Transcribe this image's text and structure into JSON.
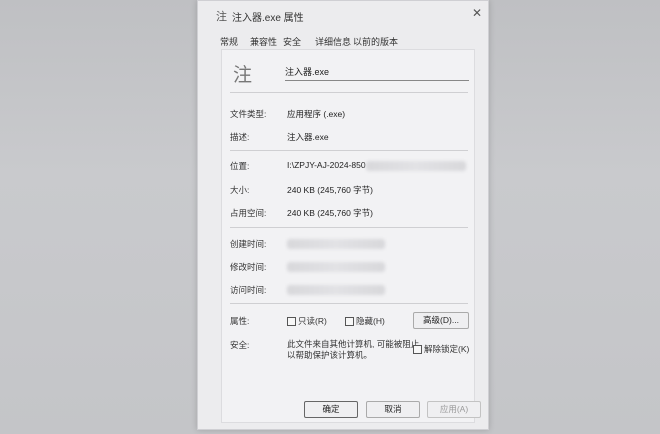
{
  "window": {
    "title_icon": "注",
    "title": "注入器.exe 属性",
    "close_icon": "✕"
  },
  "tabs": [
    {
      "label": "常规"
    },
    {
      "label": "兼容性"
    },
    {
      "label": "安全"
    },
    {
      "label": "详细信息"
    },
    {
      "label": "以前的版本"
    }
  ],
  "general": {
    "icon_glyph": "注",
    "filename": "注入器.exe",
    "file_type_label": "文件类型:",
    "file_type": "应用程序 (.exe)",
    "description_label": "描述:",
    "description": "注入器.exe",
    "location_label": "位置:",
    "location": "I:\\ZPJY-AJ-2024-850",
    "size_label": "大小:",
    "size": "240 KB (245,760 字节)",
    "size_on_disk_label": "占用空间:",
    "size_on_disk": "240 KB (245,760 字节)",
    "created_label": "创建时间:",
    "modified_label": "修改时间:",
    "accessed_label": "访问时间:",
    "attributes_label": "属性:",
    "readonly_label": "只读(R)",
    "hidden_label": "隐藏(H)",
    "advanced_button": "高级(D)...",
    "security_label": "安全:",
    "security_line1": "此文件来自其他计算机, 可能被阻止",
    "security_line2": "以帮助保护该计算机。",
    "unblock_label": "解除锁定(K)"
  },
  "footer": {
    "ok": "确定",
    "cancel": "取消",
    "apply": "应用(A)"
  }
}
